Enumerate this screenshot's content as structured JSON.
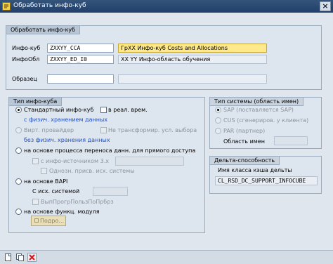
{
  "window": {
    "title": "Обработать инфо-куб"
  },
  "main_group": {
    "tab": "Обработать инфо-куб",
    "infocube_label": "Инфо-куб",
    "infocube_value": "ZXXYY_CCA",
    "infocube_desc": "ГрXX Инфо-куб Costs and Allocations",
    "infoarea_label": "ИнфоОбл",
    "infoarea_value": "ZXXYY_ED_I0",
    "infoarea_desc": "XX YY Инфо-область обучения",
    "template_label": "Образец",
    "template_value": "",
    "template_desc": ""
  },
  "cube_type": {
    "tab": "Тип инфо-куба",
    "standard": "Стандартный инфо-куб",
    "realtime": "в реал. врем.",
    "phys_storage": "с физич. хранением данных",
    "virtual_provider": "Вирт. провайдер",
    "no_transform": "Не трансформир. усл. выбора",
    "no_phys_storage": "без физич. хранения данных",
    "dtp_based": "на основе процесса переноса данн. для прямого доступа",
    "with_sources": "с инфо-источником 3.х",
    "single_assign": "Однозн. присв. исх. системы",
    "bapi_based": "на основе BAPI",
    "source_system": "С исх. системой",
    "exec_func": "ВыпПрогрПользПоПрбрз",
    "func_module": "на основе функц. модуля",
    "details_button": "Подро..."
  },
  "system_type": {
    "tab": "Тип системы (область имен)",
    "sap": "SAP (поставляется SAP)",
    "cus": "CUS (сгенериров. у клиента)",
    "par": "PAR (партнер)",
    "namespace_label": "Область имен",
    "namespace_value": ""
  },
  "delta": {
    "tab": "Дельта-способность",
    "cache_class_label": "Имя класса кэша дельты",
    "cache_class_value": "CL_RSD_DC_SUPPORT_INFOCUBE"
  },
  "toolbar": {
    "items": [
      "create-icon",
      "copy-icon",
      "cancel-icon"
    ]
  },
  "colors": {
    "title_bar": "#2a4870",
    "background": "#dfe6ee",
    "highlight_field": "#ffe98a",
    "blue_text": "#2050c8"
  }
}
